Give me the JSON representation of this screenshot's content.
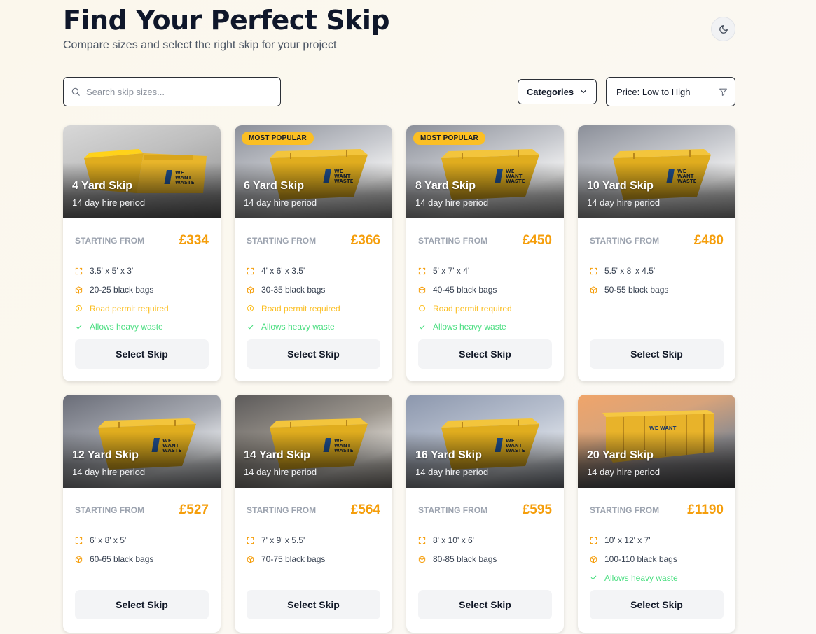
{
  "header": {
    "title": "Find Your Perfect Skip",
    "subtitle": "Compare sizes and select the right skip for your project"
  },
  "search": {
    "placeholder": "Search skip sizes...",
    "value": ""
  },
  "filters": {
    "categories_label": "Categories",
    "sort_value": "Price: Low to High"
  },
  "common": {
    "price_label": "STARTING FROM",
    "select_label": "Select Skip"
  },
  "skips": [
    {
      "name": "4 Yard Skip",
      "period": "14 day hire period",
      "price": "£334",
      "badge": "",
      "dims": "3.5' x 5' x 3'",
      "bags": "20-25 black bags",
      "permit": "Road permit required",
      "heavy": "Allows heavy waste"
    },
    {
      "name": "6 Yard Skip",
      "period": "14 day hire period",
      "price": "£366",
      "badge": "MOST POPULAR",
      "dims": "4' x 6' x 3.5'",
      "bags": "30-35 black bags",
      "permit": "Road permit required",
      "heavy": "Allows heavy waste"
    },
    {
      "name": "8 Yard Skip",
      "period": "14 day hire period",
      "price": "£450",
      "badge": "MOST POPULAR",
      "dims": "5' x 7' x 4'",
      "bags": "40-45 black bags",
      "permit": "Road permit required",
      "heavy": "Allows heavy waste"
    },
    {
      "name": "10 Yard Skip",
      "period": "14 day hire period",
      "price": "£480",
      "badge": "",
      "dims": "5.5' x 8' x 4.5'",
      "bags": "50-55 black bags",
      "permit": "",
      "heavy": ""
    },
    {
      "name": "12 Yard Skip",
      "period": "14 day hire period",
      "price": "£527",
      "badge": "",
      "dims": "6' x 8' x 5'",
      "bags": "60-65 black bags",
      "permit": "",
      "heavy": ""
    },
    {
      "name": "14 Yard Skip",
      "period": "14 day hire period",
      "price": "£564",
      "badge": "",
      "dims": "7' x 9' x 5.5'",
      "bags": "70-75 black bags",
      "permit": "",
      "heavy": ""
    },
    {
      "name": "16 Yard Skip",
      "period": "14 day hire period",
      "price": "£595",
      "badge": "",
      "dims": "8' x 10' x 6'",
      "bags": "80-85 black bags",
      "permit": "",
      "heavy": ""
    },
    {
      "name": "20 Yard Skip",
      "period": "14 day hire period",
      "price": "£1190",
      "badge": "",
      "dims": "10' x 12' x 7'",
      "bags": "100-110 black bags",
      "permit": "",
      "heavy": "Allows heavy waste"
    }
  ]
}
